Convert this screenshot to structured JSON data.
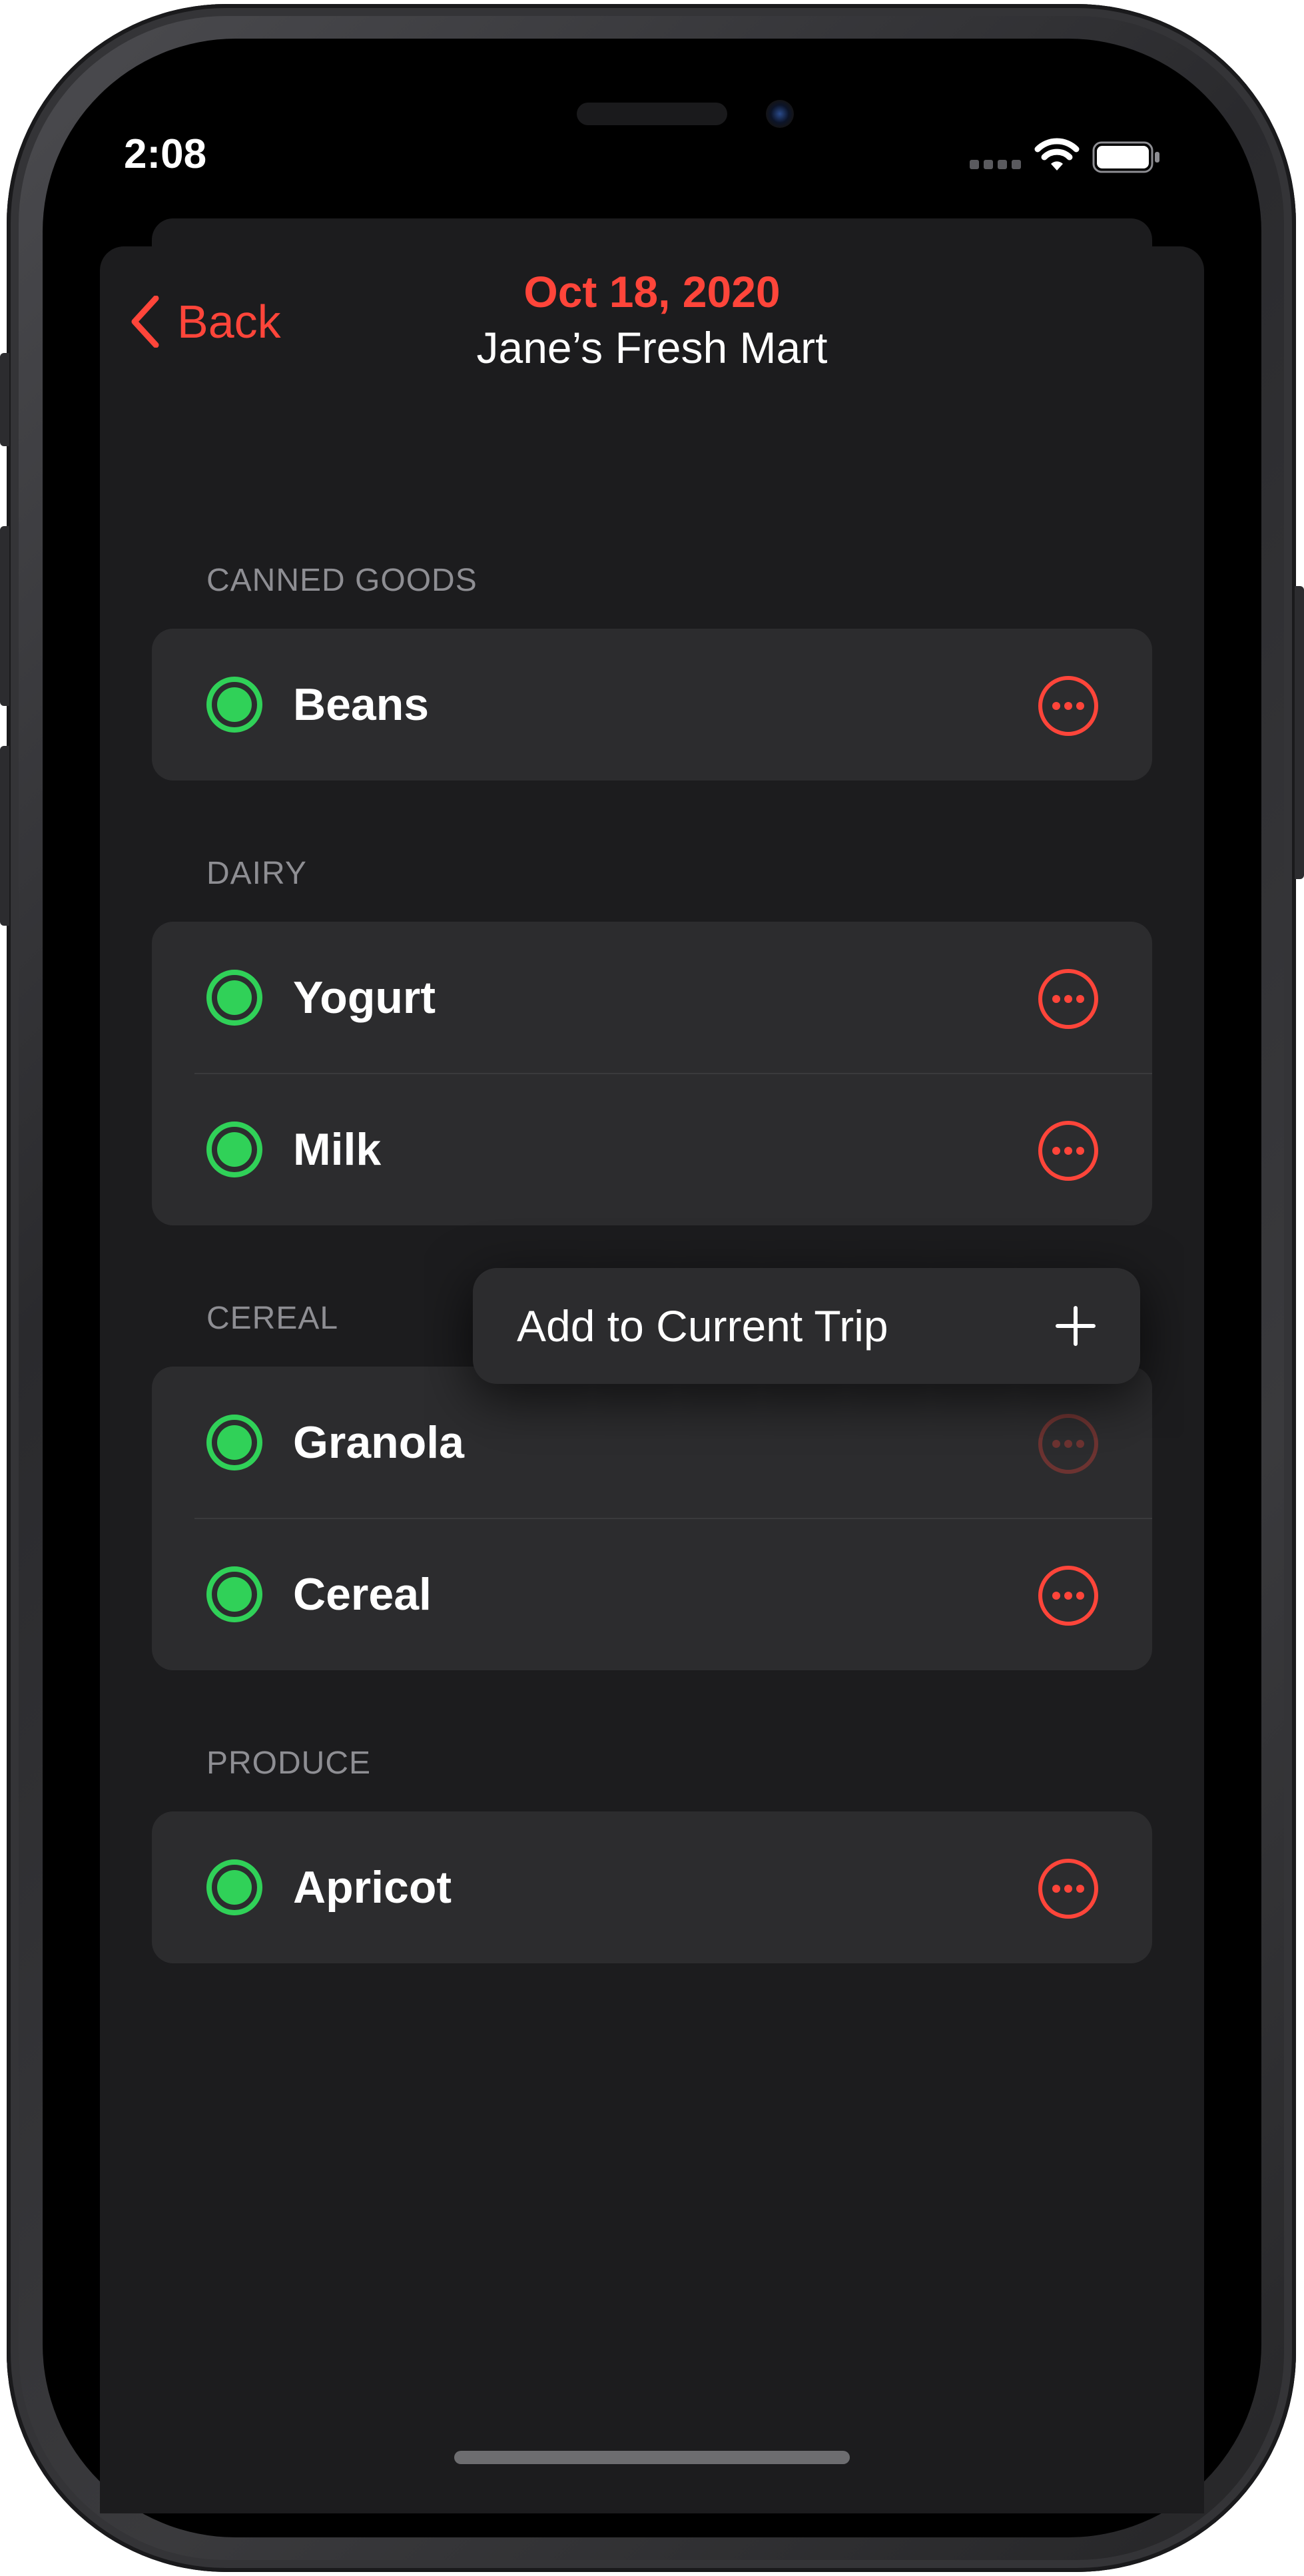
{
  "status_bar": {
    "time": "2:08"
  },
  "nav": {
    "back_label": "Back",
    "date": "Oct 18, 2020",
    "store": "Jane’s Fresh Mart"
  },
  "sections": [
    {
      "header": "CANNED GOODS",
      "items": [
        {
          "name": "Beans"
        }
      ]
    },
    {
      "header": "DAIRY",
      "items": [
        {
          "name": "Yogurt"
        },
        {
          "name": "Milk"
        }
      ]
    },
    {
      "header": "CEREAL",
      "items": [
        {
          "name": "Granola"
        },
        {
          "name": "Cereal"
        }
      ]
    },
    {
      "header": "PRODUCE",
      "items": [
        {
          "name": "Apricot"
        }
      ]
    }
  ],
  "context_menu": {
    "label": "Add to Current Trip",
    "icon": "plus-icon"
  },
  "icons": {
    "back": "chevron-left-icon",
    "check": "checkmark-circle-icon",
    "more": "ellipsis-circle-icon",
    "wifi": "wifi-icon",
    "battery": "battery-icon",
    "signal": "cellular-signal-icon"
  },
  "colors": {
    "accent": "#ff453a",
    "check": "#30d158",
    "background": "#1c1c1e",
    "cell": "#2c2c2e",
    "secondary_text": "#8e8e93"
  }
}
